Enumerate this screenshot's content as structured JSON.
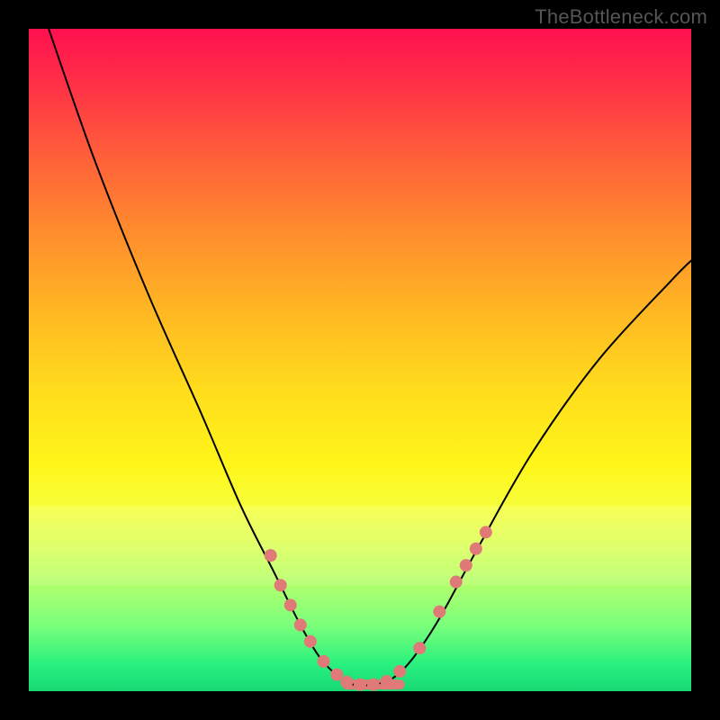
{
  "watermark": "TheBottleneck.com",
  "chart_data": {
    "type": "line",
    "title": "",
    "xlabel": "",
    "ylabel": "",
    "xlim": [
      0,
      100
    ],
    "ylim": [
      0,
      100
    ],
    "grid": false,
    "legend": false,
    "series": [
      {
        "name": "bottleneck-curve",
        "x": [
          3,
          10,
          18,
          26,
          32,
          37,
          41,
          44,
          47,
          49,
          52,
          55,
          58,
          62,
          68,
          76,
          86,
          97,
          100
        ],
        "y": [
          100,
          80,
          60,
          42,
          28,
          18,
          10,
          5,
          2,
          1,
          1,
          2,
          5,
          11,
          22,
          36,
          50,
          62,
          65
        ],
        "stroke": "#000000",
        "stroke_width": 2
      }
    ],
    "scatter": {
      "name": "marker-dots",
      "color": "#e07a78",
      "radius": 7,
      "points": [
        {
          "x": 36.5,
          "y": 20.5
        },
        {
          "x": 38.0,
          "y": 16.0
        },
        {
          "x": 39.5,
          "y": 13.0
        },
        {
          "x": 41.0,
          "y": 10.0
        },
        {
          "x": 42.5,
          "y": 7.5
        },
        {
          "x": 44.5,
          "y": 4.5
        },
        {
          "x": 46.5,
          "y": 2.5
        },
        {
          "x": 48.0,
          "y": 1.4
        },
        {
          "x": 50.0,
          "y": 1.0
        },
        {
          "x": 52.0,
          "y": 1.0
        },
        {
          "x": 54.0,
          "y": 1.5
        },
        {
          "x": 56.0,
          "y": 3.0
        },
        {
          "x": 59.0,
          "y": 6.5
        },
        {
          "x": 62.0,
          "y": 12.0
        },
        {
          "x": 64.5,
          "y": 16.5
        },
        {
          "x": 66.0,
          "y": 19.0
        },
        {
          "x": 67.5,
          "y": 21.5
        },
        {
          "x": 69.0,
          "y": 24.0
        }
      ]
    },
    "flat_segment": {
      "x0": 48,
      "x1": 56,
      "y": 1.0,
      "stroke": "#e07a78",
      "stroke_width": 11
    },
    "background_bands": [
      {
        "y0": 72,
        "y1": 76,
        "opacity": 0.35
      },
      {
        "y0": 76,
        "y1": 80,
        "opacity": 0.3
      },
      {
        "y0": 80,
        "y1": 84,
        "opacity": 0.25
      }
    ]
  }
}
